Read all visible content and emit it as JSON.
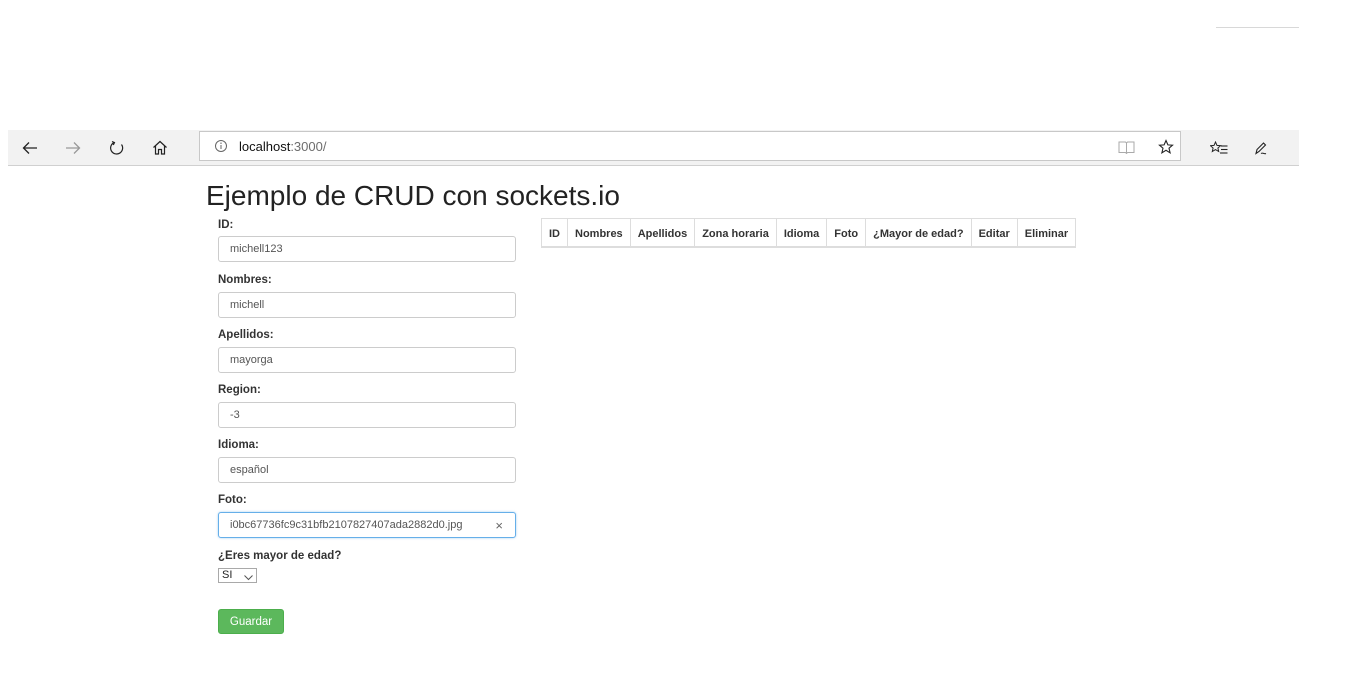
{
  "browser": {
    "url_host": "localhost",
    "url_rest": ":3000/",
    "icons": [
      "back-icon",
      "forward-icon",
      "refresh-icon",
      "home-icon",
      "info-icon",
      "reading-view-icon",
      "favorite-star-icon",
      "favorites-list-icon",
      "pen-icon"
    ]
  },
  "page": {
    "title": "Ejemplo de CRUD con sockets.io"
  },
  "form": {
    "id_label": "ID:",
    "id_value": "michell123",
    "nombres_label": "Nombres:",
    "nombres_value": "michell",
    "apellidos_label": "Apellidos:",
    "apellidos_value": "mayorga",
    "region_label": "Region:",
    "region_value": "-3",
    "idioma_label": "Idioma:",
    "idioma_value": "español",
    "foto_label": "Foto:",
    "foto_value": "i0bc67736fc9c31bfb2107827407ada2882d0.jpg",
    "foto_clear": "×",
    "mayor_label": "¿Eres mayor de edad?",
    "mayor_value": "SI",
    "save_label": "Guardar"
  },
  "table": {
    "headers": [
      "ID",
      "Nombres",
      "Apellidos",
      "Zona horaria",
      "Idioma",
      "Foto",
      "¿Mayor de edad?",
      "Editar",
      "Eliminar"
    ]
  },
  "colors": {
    "save_button": "#5cb85c",
    "focus_border": "#66afe9"
  }
}
